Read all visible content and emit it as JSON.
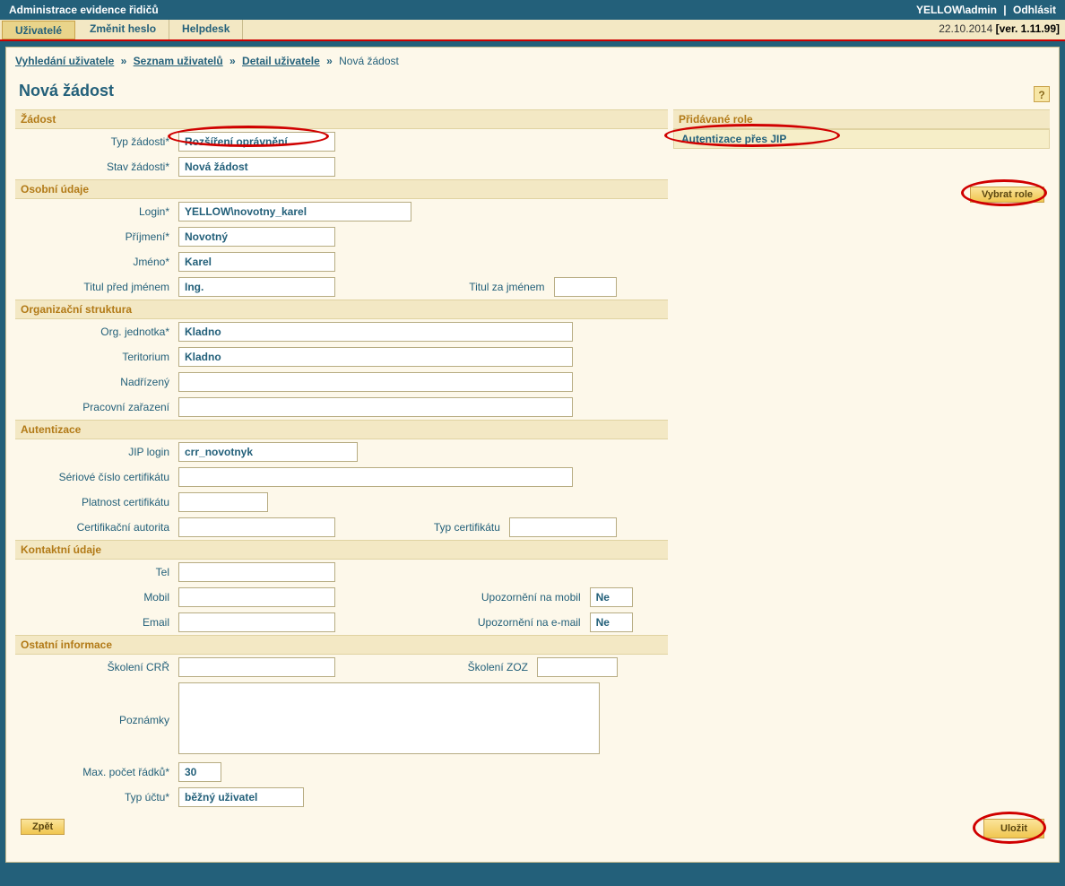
{
  "header": {
    "app_title": "Administrace evidence řidičů",
    "user_label": "YELLOW\\admin",
    "logout": "Odhlásit"
  },
  "menu": {
    "tabs": [
      "Uživatelé",
      "Změnit heslo",
      "Helpdesk"
    ],
    "date": "22.10.2014",
    "version": "[ver. 1.11.99]"
  },
  "breadcrumb": {
    "items": [
      "Vyhledání uživatele",
      "Seznam uživatelů",
      "Detail uživatele"
    ],
    "current": "Nová žádost"
  },
  "page": {
    "title": "Nová žádost",
    "help": "?"
  },
  "sections": {
    "zadost": "Žádost",
    "osobni": "Osobní údaje",
    "org": "Organizační struktura",
    "auth": "Autentizace",
    "kontakt": "Kontaktní údaje",
    "ostatni": "Ostatní informace",
    "roles": "Přidávané role"
  },
  "labels": {
    "typ_zadosti": "Typ žádosti*",
    "stav_zadosti": "Stav žádosti*",
    "login": "Login*",
    "prijmeni": "Příjmení*",
    "jmeno": "Jméno*",
    "titul_pred": "Titul před jménem",
    "titul_za": "Titul za jménem",
    "org_jednotka": "Org. jednotka*",
    "teritorium": "Teritorium",
    "nadrizeny": "Nadřízený",
    "pracovni": "Pracovní zařazení",
    "jip_login": "JIP login",
    "cert_serial": "Sériové číslo certifikátu",
    "cert_valid": "Platnost certifikátu",
    "cert_auth": "Certifikační autorita",
    "cert_type": "Typ certifikátu",
    "tel": "Tel",
    "mobil": "Mobil",
    "upoz_mobil": "Upozornění na mobil",
    "email": "Email",
    "upoz_email": "Upozornění na e-mail",
    "skoleni_crr": "Školení CRŘ",
    "skoleni_zoz": "Školení ZOZ",
    "poznamky": "Poznámky",
    "max_radku": "Max. počet řádků*",
    "typ_uctu": "Typ účtu*"
  },
  "values": {
    "typ_zadosti": "Rozšíření oprávnění",
    "stav_zadosti": "Nová žádost",
    "login": "YELLOW\\novotny_karel",
    "prijmeni": "Novotný",
    "jmeno": "Karel",
    "titul_pred": "Ing.",
    "titul_za": "",
    "org_jednotka": "Kladno",
    "teritorium": "Kladno",
    "nadrizeny": "",
    "pracovni": "",
    "jip_login": "crr_novotnyk",
    "cert_serial": "",
    "cert_valid": "",
    "cert_auth": "",
    "cert_type": "",
    "tel": "",
    "mobil": "",
    "upoz_mobil": "Ne",
    "email": "",
    "upoz_email": "Ne",
    "skoleni_crr": "",
    "skoleni_zoz": "",
    "poznamky": "",
    "max_radku": "30",
    "typ_uctu": "běžný uživatel"
  },
  "roles": {
    "items": [
      "Autentizace přes JIP"
    ],
    "select_btn": "Vybrat role"
  },
  "buttons": {
    "back": "Zpět",
    "save": "Uložit"
  }
}
